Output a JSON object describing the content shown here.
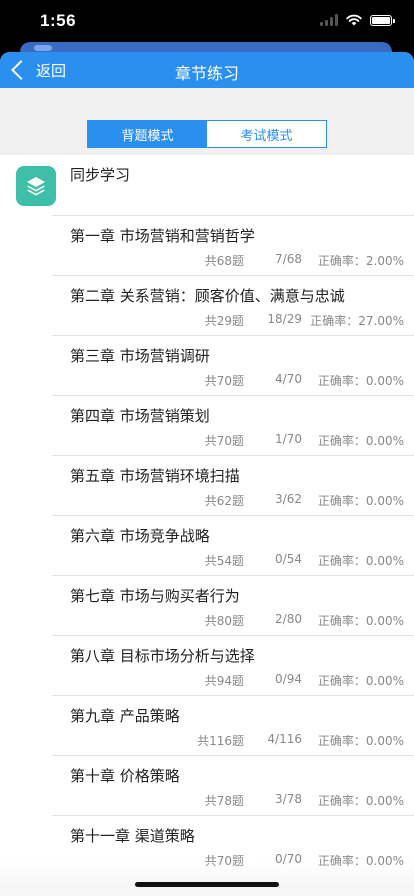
{
  "status_bar": {
    "time": "1:56"
  },
  "nav": {
    "back_label": "返回",
    "title": "章节练习"
  },
  "mode_toggle": {
    "options": [
      "背题模式",
      "考试模式"
    ],
    "selected": "背题模式"
  },
  "section": {
    "title": "同步学习",
    "icon": "layers-icon"
  },
  "chapters": [
    {
      "title": "第一章 市场营销和营销哲学",
      "total": "共68题",
      "progress": "7/68",
      "accuracy": "正确率：2.00%"
    },
    {
      "title": "第二章 关系营销：顾客价值、满意与忠诚",
      "total": "共29题",
      "progress": "18/29",
      "accuracy": "正确率：27.00%"
    },
    {
      "title": "第三章 市场营销调研",
      "total": "共70题",
      "progress": "4/70",
      "accuracy": "正确率：0.00%"
    },
    {
      "title": "第四章 市场营销策划",
      "total": "共70题",
      "progress": "1/70",
      "accuracy": "正确率：0.00%"
    },
    {
      "title": "第五章 市场营销环境扫描",
      "total": "共62题",
      "progress": "3/62",
      "accuracy": "正确率：0.00%"
    },
    {
      "title": "第六章 市场竞争战略",
      "total": "共54题",
      "progress": "0/54",
      "accuracy": "正确率：0.00%"
    },
    {
      "title": "第七章 市场与购买者行为",
      "total": "共80题",
      "progress": "2/80",
      "accuracy": "正确率：0.00%"
    },
    {
      "title": "第八章 目标市场分析与选择",
      "total": "共94题",
      "progress": "0/94",
      "accuracy": "正确率：0.00%"
    },
    {
      "title": "第九章 产品策略",
      "total": "共116题",
      "progress": "4/116",
      "accuracy": "正确率：0.00%"
    },
    {
      "title": "第十章 价格策略",
      "total": "共78题",
      "progress": "3/78",
      "accuracy": "正确率：0.00%"
    },
    {
      "title": "第十一章 渠道策略",
      "total": "共70题",
      "progress": "0/70",
      "accuracy": "正确率：0.00%"
    }
  ],
  "colors": {
    "accent": "#2b8ff0",
    "icon_bg": "#3fbfaa"
  }
}
